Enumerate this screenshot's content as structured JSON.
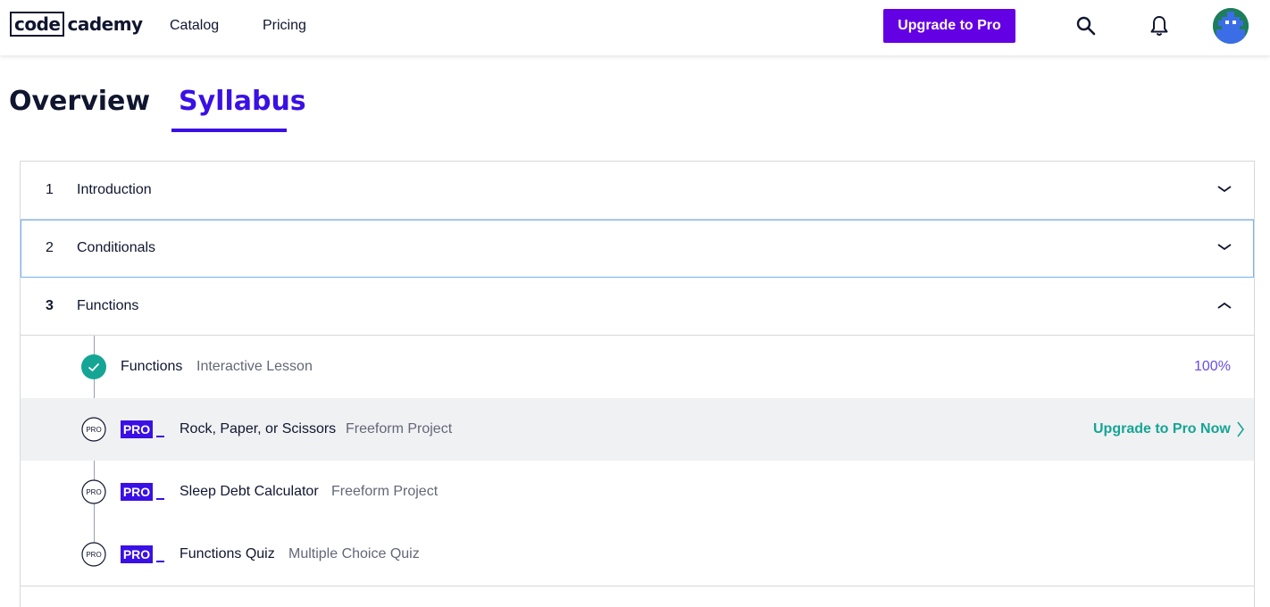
{
  "header": {
    "logo_code": "code",
    "logo_rest": "cademy",
    "nav": [
      "Catalog",
      "Pricing"
    ],
    "upgrade_label": "Upgrade to Pro",
    "icons": [
      "search-icon",
      "bell-icon",
      "avatar"
    ]
  },
  "tabs": {
    "overview": "Overview",
    "syllabus": "Syllabus",
    "active": "Syllabus"
  },
  "modules": [
    {
      "number": "1",
      "title": "Introduction",
      "expanded": false
    },
    {
      "number": "2",
      "title": "Conditionals",
      "expanded": false
    },
    {
      "number": "3",
      "title": "Functions",
      "expanded": true
    }
  ],
  "lessons": [
    {
      "name": "Functions",
      "type": "Interactive Lesson",
      "status": "complete",
      "progress": "100%"
    },
    {
      "pro": "PRO",
      "name": "Rock, Paper, or Scissors",
      "type": "Freeform Project",
      "status": "locked",
      "cta": "Upgrade to Pro Now"
    },
    {
      "pro": "PRO",
      "name": "Sleep Debt Calculator",
      "type": "Freeform Project",
      "status": "locked"
    },
    {
      "pro": "PRO",
      "name": "Functions Quiz",
      "type": "Multiple Choice Quiz",
      "status": "locked"
    }
  ],
  "marker_label": "PRO",
  "colors": {
    "brand_purple": "#6400e4",
    "accent_blue": "#3a10e5",
    "complete_green": "#15a595",
    "progress_purple": "#6b4ce6"
  }
}
